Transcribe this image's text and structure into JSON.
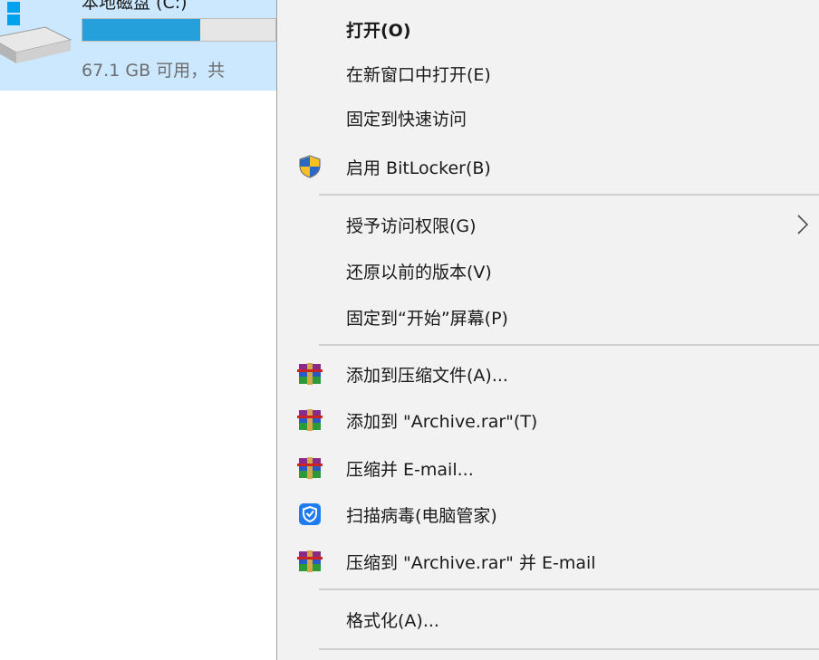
{
  "drive": {
    "name": "本地磁盘 (C:)",
    "space_text": "67.1 GB 可用，共",
    "used_fraction": 0.61,
    "icon": "hard-drive-icon"
  },
  "menu": {
    "open": "打开(O)",
    "open_new_window": "在新窗口中打开(E)",
    "pin_quick_access": "固定到快速访问",
    "bitlocker": "启用 BitLocker(B)",
    "give_access": "授予访问权限(G)",
    "restore_previous": "还原以前的版本(V)",
    "pin_start": "固定到“开始”屏幕(P)",
    "add_to_archive": "添加到压缩文件(A)...",
    "add_to_archive_rar": "添加到 \"Archive.rar\"(T)",
    "compress_email": "压缩并 E-mail...",
    "scan_virus": "扫描病毒(电脑管家)",
    "compress_rar_email": "压缩到 \"Archive.rar\" 并 E-mail",
    "format": "格式化(A)..."
  },
  "icons": {
    "bitlocker": "shield-icon",
    "winrar": "winrar-icon",
    "virus_scan": "pc-manager-shield-icon",
    "submenu": "chevron-right-icon"
  },
  "colors": {
    "selection": "#cce8ff",
    "menu_bg": "#f2f2f2",
    "drive_bar": "#26a0da"
  }
}
